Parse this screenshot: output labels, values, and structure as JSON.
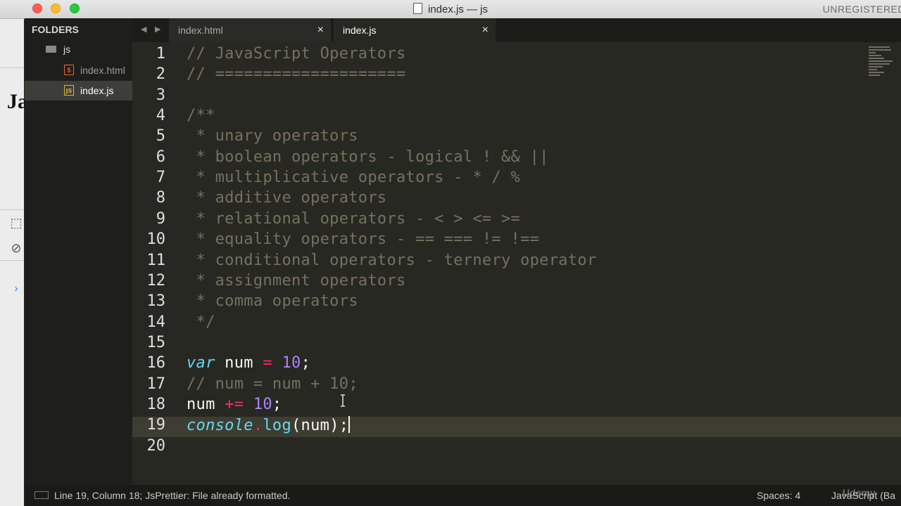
{
  "window": {
    "title": "index.js — js",
    "registration": "UNREGISTERED"
  },
  "background_window": {
    "partial_text": "Ja"
  },
  "sidebar": {
    "header": "FOLDERS",
    "folder": "js",
    "files": [
      {
        "label": "index.html",
        "icon": "html5-icon",
        "active": false
      },
      {
        "label": "index.js",
        "icon": "js-file-icon",
        "active": true
      }
    ]
  },
  "tabs": [
    {
      "label": "index.html",
      "active": false,
      "close": "×"
    },
    {
      "label": "index.js",
      "active": true,
      "close": "×"
    }
  ],
  "editor": {
    "current_line": 19,
    "lines": [
      {
        "n": "1",
        "tokens": [
          {
            "t": "// JavaScript Operators",
            "c": "comment"
          }
        ]
      },
      {
        "n": "2",
        "tokens": [
          {
            "t": "// ====================",
            "c": "comment"
          }
        ]
      },
      {
        "n": "3",
        "tokens": []
      },
      {
        "n": "4",
        "tokens": [
          {
            "t": "/**",
            "c": "comment"
          }
        ]
      },
      {
        "n": "5",
        "tokens": [
          {
            "t": " * unary operators",
            "c": "comment"
          }
        ]
      },
      {
        "n": "6",
        "tokens": [
          {
            "t": " * boolean operators - logical ! && ||",
            "c": "comment"
          }
        ]
      },
      {
        "n": "7",
        "tokens": [
          {
            "t": " * multiplicative operators - * / %",
            "c": "comment"
          }
        ]
      },
      {
        "n": "8",
        "tokens": [
          {
            "t": " * additive operators",
            "c": "comment"
          }
        ]
      },
      {
        "n": "9",
        "tokens": [
          {
            "t": " * relational operators - < > <= >=",
            "c": "comment"
          }
        ]
      },
      {
        "n": "10",
        "tokens": [
          {
            "t": " * equality operators - == === != !==",
            "c": "comment"
          }
        ]
      },
      {
        "n": "11",
        "tokens": [
          {
            "t": " * conditional operators - ternery operator",
            "c": "comment"
          }
        ]
      },
      {
        "n": "12",
        "tokens": [
          {
            "t": " * assignment operators",
            "c": "comment"
          }
        ]
      },
      {
        "n": "13",
        "tokens": [
          {
            "t": " * comma operators",
            "c": "comment"
          }
        ]
      },
      {
        "n": "14",
        "tokens": [
          {
            "t": " */",
            "c": "comment"
          }
        ]
      },
      {
        "n": "15",
        "tokens": []
      },
      {
        "n": "16",
        "tokens": [
          {
            "t": "var",
            "c": "kw"
          },
          {
            "t": " num ",
            "c": "plain"
          },
          {
            "t": "=",
            "c": "op"
          },
          {
            "t": " ",
            "c": "plain"
          },
          {
            "t": "10",
            "c": "num"
          },
          {
            "t": ";",
            "c": "plain"
          }
        ]
      },
      {
        "n": "17",
        "tokens": [
          {
            "t": "// num = num + 10;",
            "c": "comment"
          }
        ]
      },
      {
        "n": "18",
        "tokens": [
          {
            "t": "num ",
            "c": "plain"
          },
          {
            "t": "+=",
            "c": "op"
          },
          {
            "t": " ",
            "c": "plain"
          },
          {
            "t": "10",
            "c": "num"
          },
          {
            "t": ";",
            "c": "plain"
          }
        ]
      },
      {
        "n": "19",
        "tokens": [
          {
            "t": "console",
            "c": "obj"
          },
          {
            "t": ".",
            "c": "op"
          },
          {
            "t": "log",
            "c": "fn"
          },
          {
            "t": "(num);",
            "c": "plain"
          }
        ],
        "caret": true
      },
      {
        "n": "20",
        "tokens": []
      }
    ]
  },
  "status": {
    "text": "Line 19, Column 18; JsPrettier: File already formatted.",
    "spaces": "Spaces: 4",
    "syntax": "JavaScript (Ba",
    "watermark": "Udemy"
  },
  "colors": {
    "editor_bg": "#272822",
    "comment": "#75715e",
    "keyword": "#66d9ef",
    "operator": "#f92672",
    "number": "#ae81ff"
  }
}
